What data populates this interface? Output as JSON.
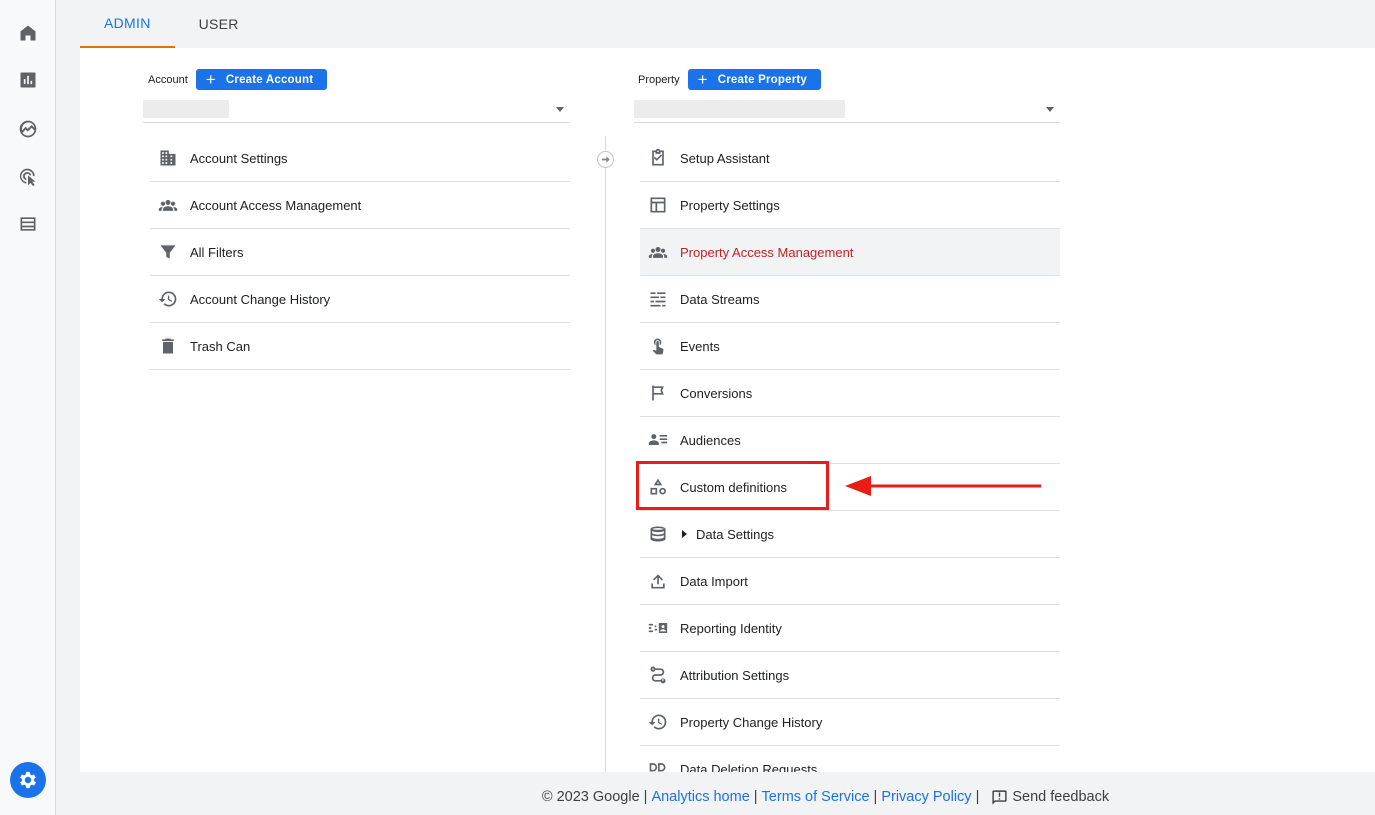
{
  "tabs": {
    "admin": "ADMIN",
    "user": "USER"
  },
  "account": {
    "label": "Account",
    "create_label": "Create Account",
    "items": [
      {
        "label": "Account Settings",
        "icon": "building-icon"
      },
      {
        "label": "Account Access Management",
        "icon": "people-icon"
      },
      {
        "label": "All Filters",
        "icon": "filter-icon"
      },
      {
        "label": "Account Change History",
        "icon": "history-icon"
      },
      {
        "label": "Trash Can",
        "icon": "trash-icon"
      }
    ]
  },
  "property": {
    "label": "Property",
    "create_label": "Create Property",
    "items": [
      {
        "label": "Setup Assistant",
        "icon": "clipboard-check-icon"
      },
      {
        "label": "Property Settings",
        "icon": "layout-icon"
      },
      {
        "label": "Property Access Management",
        "icon": "people-icon",
        "selected": true
      },
      {
        "label": "Data Streams",
        "icon": "streams-icon"
      },
      {
        "label": "Events",
        "icon": "touch-icon"
      },
      {
        "label": "Conversions",
        "icon": "flag-icon"
      },
      {
        "label": "Audiences",
        "icon": "audience-icon"
      },
      {
        "label": "Custom definitions",
        "icon": "shapes-icon"
      },
      {
        "label": "Data Settings",
        "icon": "database-icon"
      },
      {
        "label": "Data Import",
        "icon": "upload-icon"
      },
      {
        "label": "Reporting Identity",
        "icon": "identity-icon"
      },
      {
        "label": "Attribution Settings",
        "icon": "route-icon"
      },
      {
        "label": "Property Change History",
        "icon": "history-icon"
      },
      {
        "label": "Data Deletion Requests",
        "icon": "dd-icon"
      }
    ]
  },
  "footer": {
    "copyright": "© 2023 Google",
    "analytics_home": "Analytics home",
    "terms": "Terms of Service",
    "privacy": "Privacy Policy",
    "feedback": "Send feedback"
  },
  "colors": {
    "accent": "#1a73e8",
    "selected_text": "#c5221f",
    "tab_indicator": "#e37400",
    "annotation": "#ea1c16"
  }
}
